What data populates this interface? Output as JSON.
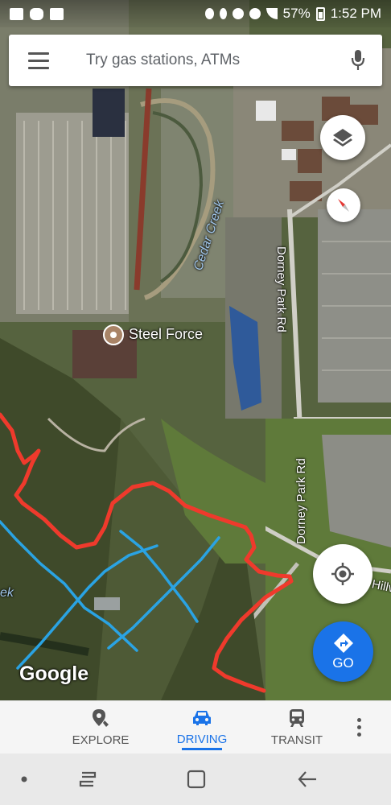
{
  "status_bar": {
    "battery": "57%",
    "time": "1:52 PM"
  },
  "search": {
    "placeholder": "Try gas stations, ATMs"
  },
  "map": {
    "poi_label": "Steel Force",
    "creek_label": "Cedar Creek",
    "road_label_1": "Dorney Park Rd",
    "road_label_2": "Dorney Park Rd",
    "road_label_3": "Hillv",
    "creek_edge_label": "ek",
    "attribution": "Google",
    "annotation_colors": {
      "red_line": "#ef3a2c",
      "blue_lines": "#2aa3e3"
    }
  },
  "go_button": {
    "label": "GO"
  },
  "tabs": [
    {
      "label": "EXPLORE",
      "icon": "explore-pin-icon",
      "active": false
    },
    {
      "label": "DRIVING",
      "icon": "car-icon",
      "active": true
    },
    {
      "label": "TRANSIT",
      "icon": "train-icon",
      "active": false
    }
  ],
  "colors": {
    "accent": "#1a73e8"
  }
}
